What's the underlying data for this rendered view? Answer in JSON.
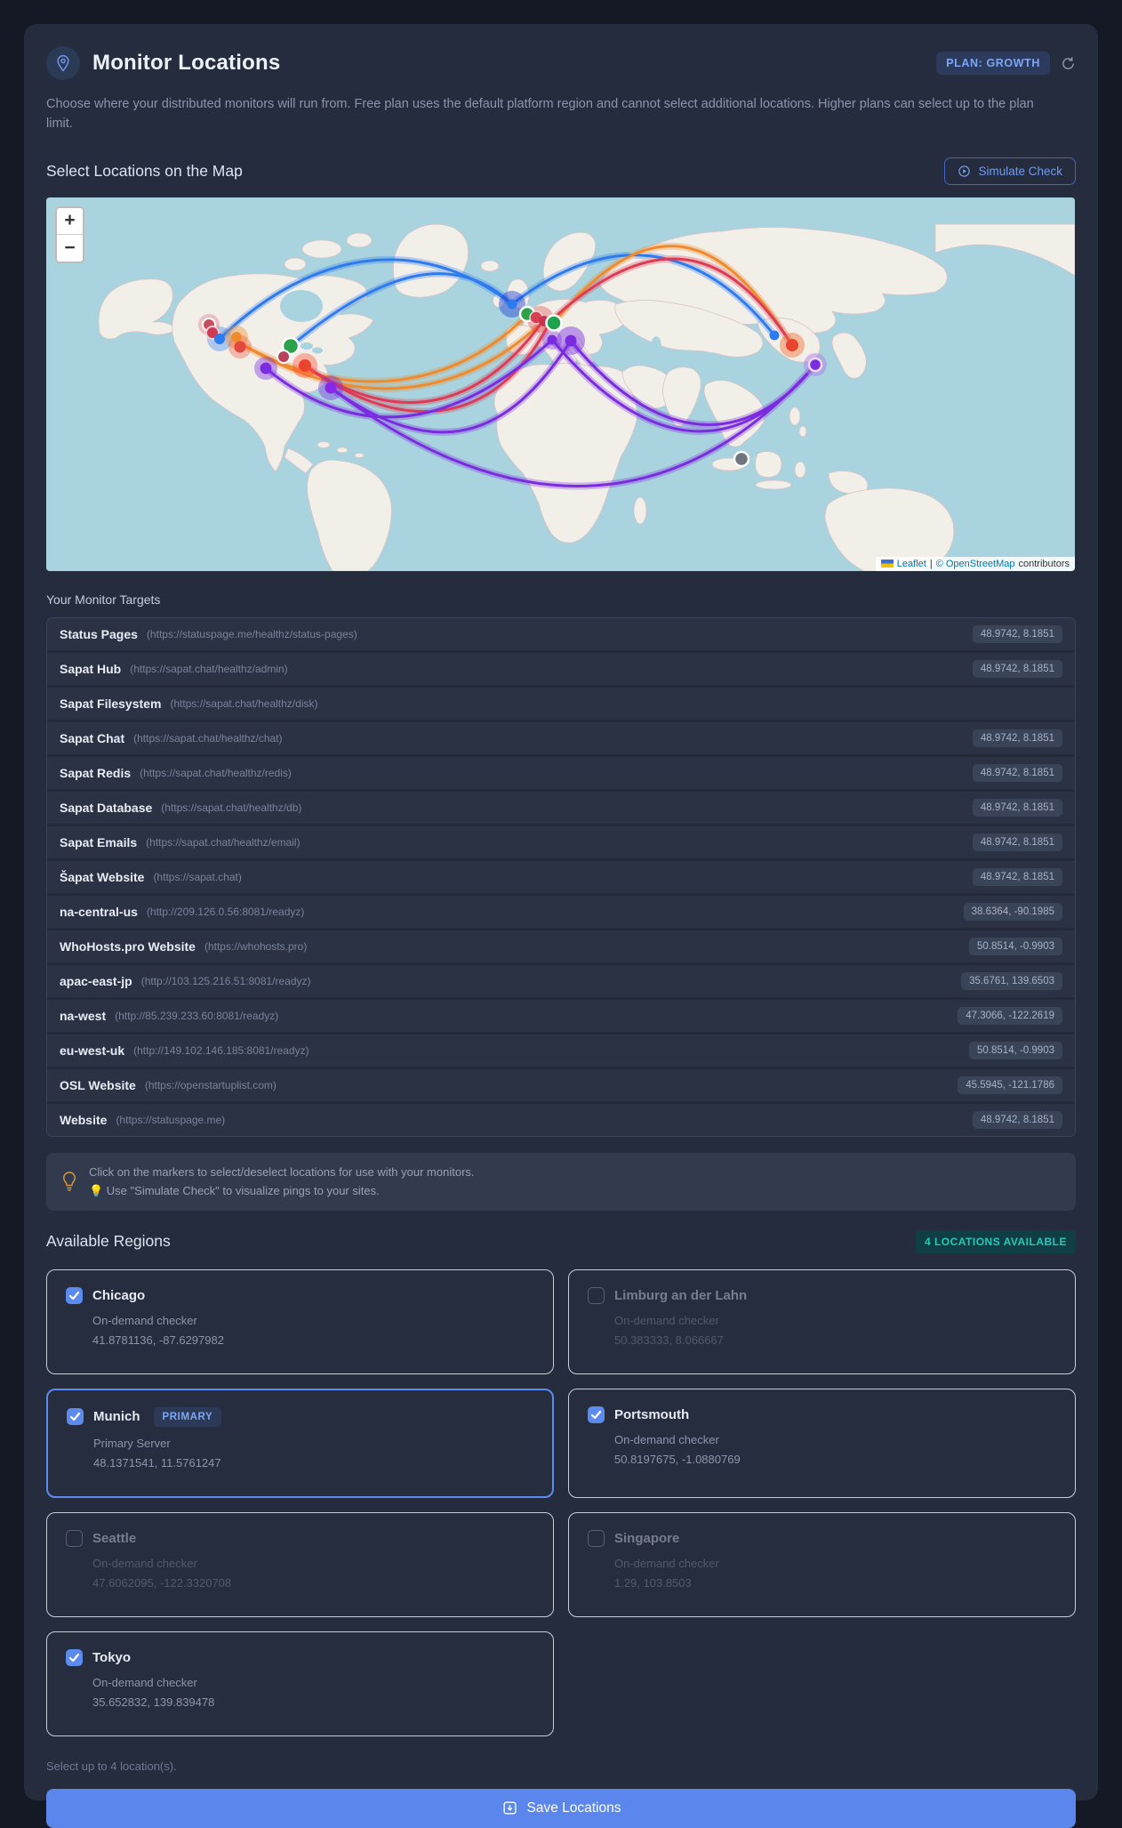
{
  "header": {
    "title": "Monitor Locations",
    "plan_badge": "PLAN: GROWTH",
    "description": "Choose where your distributed monitors will run from. Free plan uses the default platform region and cannot select additional locations. Higher plans can select up to the plan limit."
  },
  "map_section": {
    "title": "Select Locations on the Map",
    "simulate_button": "Simulate Check",
    "zoom_in": "+",
    "zoom_out": "−",
    "attribution": {
      "leaflet": "Leaflet",
      "separator": "|",
      "osm": "© OpenStreetMap",
      "suffix": "contributors"
    }
  },
  "targets": {
    "title": "Your Monitor Targets",
    "items": [
      {
        "name": "Status Pages",
        "url": "(https://statuspage.me/healthz/status-pages)",
        "coords": "48.9742, 8.1851"
      },
      {
        "name": "Sapat Hub",
        "url": "(https://sapat.chat/healthz/admin)",
        "coords": "48.9742, 8.1851"
      },
      {
        "name": "Sapat Filesystem",
        "url": "(https://sapat.chat/healthz/disk)",
        "coords": ""
      },
      {
        "name": "Sapat Chat",
        "url": "(https://sapat.chat/healthz/chat)",
        "coords": "48.9742, 8.1851"
      },
      {
        "name": "Sapat Redis",
        "url": "(https://sapat.chat/healthz/redis)",
        "coords": "48.9742, 8.1851"
      },
      {
        "name": "Sapat Database",
        "url": "(https://sapat.chat/healthz/db)",
        "coords": "48.9742, 8.1851"
      },
      {
        "name": "Sapat Emails",
        "url": "(https://sapat.chat/healthz/email)",
        "coords": "48.9742, 8.1851"
      },
      {
        "name": "Šapat Website",
        "url": "(https://sapat.chat)",
        "coords": "48.9742, 8.1851"
      },
      {
        "name": "na-central-us",
        "url": "(http://209.126.0.56:8081/readyz)",
        "coords": "38.6364, -90.1985"
      },
      {
        "name": "WhoHosts.pro Website",
        "url": "(https://whohosts.pro)",
        "coords": "50.8514, -0.9903"
      },
      {
        "name": "apac-east-jp",
        "url": "(http://103.125.216.51:8081/readyz)",
        "coords": "35.6761, 139.6503"
      },
      {
        "name": "na-west",
        "url": "(http://85.239.233.60:8081/readyz)",
        "coords": "47.3066, -122.2619"
      },
      {
        "name": "eu-west-uk",
        "url": "(http://149.102.146.185:8081/readyz)",
        "coords": "50.8514, -0.9903"
      },
      {
        "name": "OSL Website",
        "url": "(https://openstartuplist.com)",
        "coords": "45.5945, -121.1786"
      },
      {
        "name": "Website",
        "url": "(https://statuspage.me)",
        "coords": "48.9742, 8.1851"
      }
    ]
  },
  "tip": {
    "line1": "Click on the markers to select/deselect locations for use with your monitors.",
    "line2": "💡 Use \"Simulate Check\" to visualize pings to your sites."
  },
  "regions": {
    "title": "Available Regions",
    "badge": "4 LOCATIONS AVAILABLE",
    "footnote": "Select up to 4 location(s).",
    "cards": [
      {
        "name": "Chicago",
        "sub": "On-demand checker",
        "coords": "41.8781136, -87.6297982",
        "checked": true,
        "primary": false
      },
      {
        "name": "Limburg an der Lahn",
        "sub": "On-demand checker",
        "coords": "50.383333, 8.066667",
        "checked": false,
        "primary": false
      },
      {
        "name": "Munich",
        "sub": "Primary Server",
        "coords": "48.1371541, 11.5761247",
        "checked": true,
        "primary": true,
        "primary_label": "PRIMARY"
      },
      {
        "name": "Portsmouth",
        "sub": "On-demand checker",
        "coords": "50.8197675, -1.0880769",
        "checked": true,
        "primary": false
      },
      {
        "name": "Seattle",
        "sub": "On-demand checker",
        "coords": "47.6062095, -122.3320708",
        "checked": false,
        "primary": false
      },
      {
        "name": "Singapore",
        "sub": "On-demand checker",
        "coords": "1.29, 103.8503",
        "checked": false,
        "primary": false
      },
      {
        "name": "Tokyo",
        "sub": "On-demand checker",
        "coords": "35.652832, 139.839478",
        "checked": true,
        "primary": false
      }
    ]
  },
  "save_button": "Save Locations",
  "colors": {
    "accent_blue": "#5b87ed",
    "teal": "#28c8b9",
    "map_water": "#a9d3de",
    "map_land": "#f2efe9",
    "arc_blue": "#2e7bf0",
    "arc_orange": "#f08b2d",
    "arc_crimson": "#dc3d55",
    "arc_purple": "#7b2ce0"
  }
}
